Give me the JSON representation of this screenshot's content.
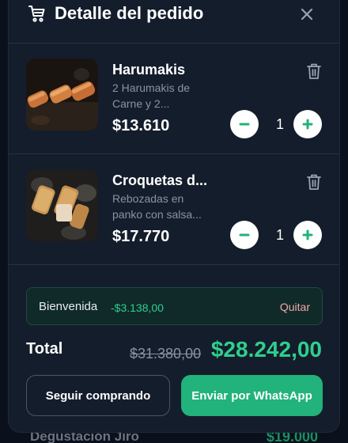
{
  "background": {
    "item_name": "Degustación Jiro",
    "item_price": "$19.000"
  },
  "modal": {
    "title": "Detalle del pedido",
    "icons": {
      "header": "cart-icon",
      "close": "close-icon",
      "remove": "trash-icon",
      "decrease": "minus-icon",
      "increase": "plus-icon"
    }
  },
  "items": [
    {
      "name": "Harumakis",
      "description": "2 Harumakis de Carne y 2...",
      "price": "$13.610",
      "quantity": "1"
    },
    {
      "name": "Croquetas d...",
      "description": "Rebozadas en panko con salsa...",
      "price": "$17.770",
      "quantity": "1"
    }
  ],
  "promo": {
    "code": "Bienvenida",
    "discount": "-$3.138,00",
    "remove_label": "Quitar"
  },
  "totals": {
    "label": "Total",
    "original": "$31.380,00",
    "final": "$28.242,00"
  },
  "actions": {
    "continue_label": "Seguir comprando",
    "send_label": "Enviar por WhatsApp"
  },
  "colors": {
    "accent": "#22b27b",
    "total_green": "#2fcf8d",
    "panel": "#141d2b",
    "remove_text": "#f3a7a7"
  }
}
